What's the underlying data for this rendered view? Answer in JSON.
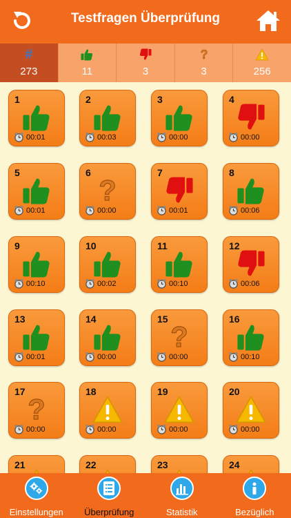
{
  "header": {
    "title": "Testfragen Überprüfung",
    "back_icon": "refresh-icon",
    "home_icon": "home-icon"
  },
  "stats": [
    {
      "symbol": "#",
      "kind": "hash",
      "value": "273",
      "active": true
    },
    {
      "symbol": "thumb-up-icon",
      "kind": "up",
      "value": "11",
      "active": false
    },
    {
      "symbol": "thumb-down-icon",
      "kind": "down",
      "value": "3",
      "active": false
    },
    {
      "symbol": "question-icon",
      "kind": "question",
      "value": "3",
      "active": false
    },
    {
      "symbol": "warning-icon",
      "kind": "warning",
      "value": "256",
      "active": false
    }
  ],
  "tiles": [
    {
      "number": "1",
      "status": "up",
      "time": "00:01"
    },
    {
      "number": "2",
      "status": "up",
      "time": "00:03"
    },
    {
      "number": "3",
      "status": "up",
      "time": "00:00"
    },
    {
      "number": "4",
      "status": "down",
      "time": "00:00"
    },
    {
      "number": "5",
      "status": "up",
      "time": "00:01"
    },
    {
      "number": "6",
      "status": "question",
      "time": "00:00"
    },
    {
      "number": "7",
      "status": "down",
      "time": "00:01"
    },
    {
      "number": "8",
      "status": "up",
      "time": "00:06"
    },
    {
      "number": "9",
      "status": "up",
      "time": "00:10"
    },
    {
      "number": "10",
      "status": "up",
      "time": "00:02"
    },
    {
      "number": "11",
      "status": "up",
      "time": "00:10"
    },
    {
      "number": "12",
      "status": "down",
      "time": "00:06"
    },
    {
      "number": "13",
      "status": "up",
      "time": "00:01"
    },
    {
      "number": "14",
      "status": "up",
      "time": "00:00"
    },
    {
      "number": "15",
      "status": "question",
      "time": "00:00"
    },
    {
      "number": "16",
      "status": "up",
      "time": "00:10"
    },
    {
      "number": "17",
      "status": "question",
      "time": "00:00"
    },
    {
      "number": "18",
      "status": "warning",
      "time": "00:00"
    },
    {
      "number": "19",
      "status": "warning",
      "time": "00:00"
    },
    {
      "number": "20",
      "status": "warning",
      "time": "00:00"
    },
    {
      "number": "21",
      "status": "warning",
      "time": ""
    },
    {
      "number": "22",
      "status": "warning",
      "time": ""
    },
    {
      "number": "23",
      "status": "warning",
      "time": ""
    },
    {
      "number": "24",
      "status": "warning",
      "time": ""
    }
  ],
  "footer": [
    {
      "label": "Einstellungen",
      "icon": "gear-icon",
      "active": false
    },
    {
      "label": "Überprüfung",
      "icon": "list-icon",
      "active": true
    },
    {
      "label": "Statistik",
      "icon": "bar-chart-icon",
      "active": false
    },
    {
      "label": "Bezüglich",
      "icon": "info-icon",
      "active": false
    }
  ],
  "colors": {
    "header": "#f26a1b",
    "tile": "#f47d17",
    "background": "#fdf6d3",
    "up": "#1f8f1f",
    "down": "#e01010",
    "question": "#d97a22",
    "warning": "#f6b800",
    "footer_icon": "#2ea8e8"
  }
}
